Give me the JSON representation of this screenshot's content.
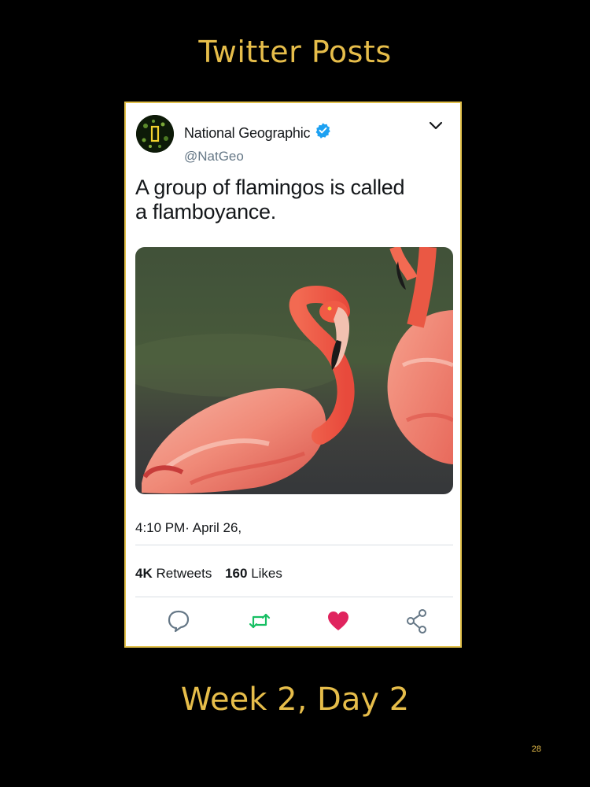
{
  "slide": {
    "title": "Twitter Posts",
    "subtitle": "Week 2, Day 2",
    "page_number": "28"
  },
  "tweet": {
    "display_name": "National Geographic",
    "handle": "@NatGeo",
    "text_line1": "A group of flamingos is called",
    "text_line2": "a flamboyance.",
    "timestamp": "4:10 PM· April 26,",
    "retweets_count": "4K",
    "retweets_label": "Retweets",
    "likes_count": "160",
    "likes_label": "Likes",
    "icons": {
      "verified": "verified-badge-icon",
      "menu": "chevron-down-icon",
      "reply": "reply-icon",
      "retweet": "retweet-icon",
      "like": "heart-icon",
      "share": "share-icon"
    }
  },
  "colors": {
    "slide_background": "#000000",
    "slide_text": "#e6bd4a",
    "frame_border": "#e1c04a",
    "verified": "#1da1f2",
    "retweet": "#17bf63",
    "like": "#e0245e",
    "icon_gray": "#657786"
  }
}
